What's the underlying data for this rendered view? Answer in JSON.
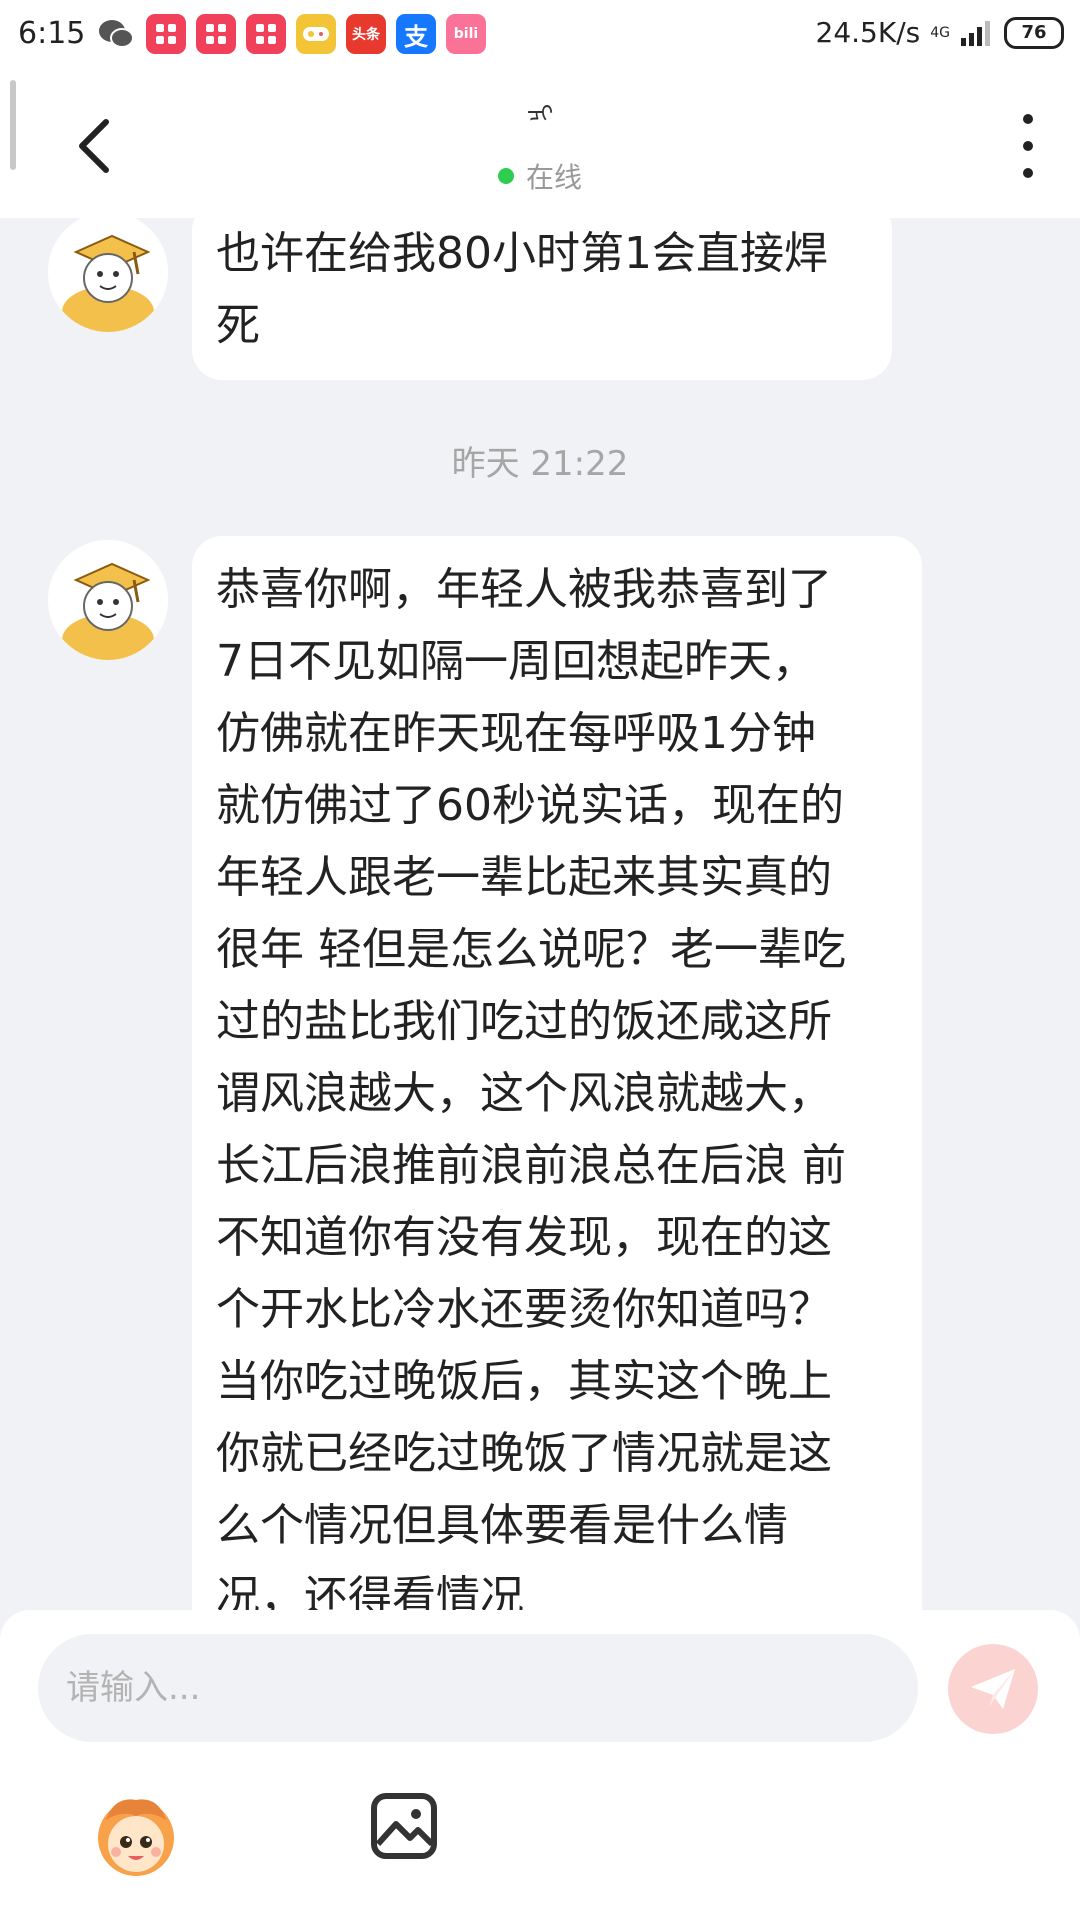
{
  "status_bar": {
    "time": "6:15",
    "app_icons": [
      {
        "name": "wechat-icon",
        "color": "#555555",
        "label": ""
      },
      {
        "name": "app-icon-1",
        "color": "#f0405a",
        "label": ""
      },
      {
        "name": "app-icon-2",
        "color": "#f0405a",
        "label": ""
      },
      {
        "name": "app-icon-3",
        "color": "#f0405a",
        "label": ""
      },
      {
        "name": "game-icon",
        "color": "#f4c437",
        "label": ""
      },
      {
        "name": "toutiao-icon",
        "color": "#e8392e",
        "label": "头条"
      },
      {
        "name": "alipay-icon",
        "color": "#1677ff",
        "label": "支"
      },
      {
        "name": "bilibili-icon",
        "color": "#fb7299",
        "label": "bili"
      }
    ],
    "network_speed": "24.5K/s",
    "network_type": "4G",
    "battery": "76"
  },
  "header": {
    "chat_name": "ᠴᠢ",
    "status_text": "在线",
    "status_color": "#2ecc50"
  },
  "messages": [
    {
      "type": "received",
      "text": "也许在给我80小时第1会直接焊\n死"
    },
    {
      "type": "timestamp",
      "text": "昨天 21:22"
    },
    {
      "type": "received",
      "text": "恭喜你啊，年轻人被我恭喜到了\n7日不见如隔一周回想起昨天，\n仿佛就在昨天现在每呼吸1分钟\n就仿佛过了60秒说实话，现在的\n年轻人跟老一辈比起来其实真的\n很年 轻但是怎么说呢？老一辈吃\n过的盐比我们吃过的饭还咸这所\n谓风浪越大，这个风浪就越大，\n长江后浪推前浪前浪总在后浪 前\n不知道你有没有发现，现在的这\n个开水比冷水还要烫你知道吗？\n当你吃过晚饭后，其实这个晚上\n你就已经吃过晚饭了情况就是这\n么个情况但具体要看是什么情\n况，还得看情况"
    }
  ],
  "input": {
    "placeholder": "请输入...",
    "value": "",
    "send_color": "#fbd4d2"
  },
  "toolbar": {
    "emoji_icon": "emoji-mascot-icon",
    "image_icon": "image-icon"
  }
}
